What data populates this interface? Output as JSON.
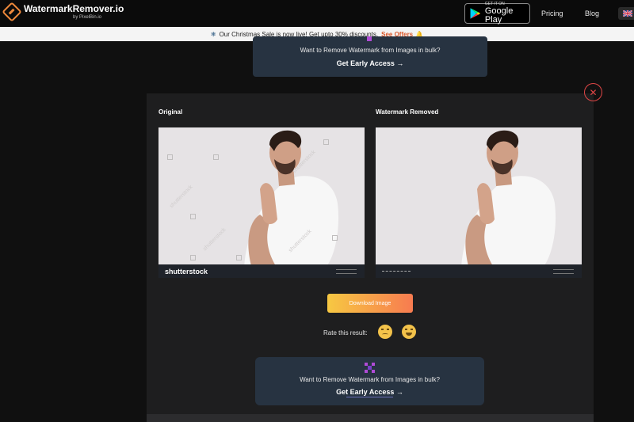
{
  "header": {
    "brand_title": "WatermarkRemover.io",
    "brand_sub": "by PixelBin.io",
    "gplay_small": "GET IT ON",
    "gplay_big": "Google Play",
    "nav_pricing": "Pricing",
    "nav_blog": "Blog"
  },
  "promo": {
    "text": "Our Christmas Sale is now live! Get upto 30% discounts.",
    "offers": "See Offers"
  },
  "bulk_card": {
    "text": "Want to Remove Watermark from Images in bulk?",
    "cta": "Get Early Access →"
  },
  "compare": {
    "original_label": "Original",
    "removed_label": "Watermark Removed",
    "watermark_logo": "shutterstock",
    "watermark_diag": "shutterstock"
  },
  "actions": {
    "download_label": "Download Image",
    "rate_label": "Rate this result:"
  },
  "colors": {
    "accent_orange": "#f08a3c",
    "close_red": "#e04646",
    "card_bg": "#273341",
    "gradient_start": "#f7c842",
    "gradient_end": "#f77b50"
  },
  "icons": {
    "logo": "watermark-remover-logo-icon",
    "close": "close-icon",
    "rate_bad": "sad-face-icon",
    "rate_good": "happy-face-icon",
    "bulk": "pixel-grid-icon",
    "language": "uk-flag-icon"
  }
}
